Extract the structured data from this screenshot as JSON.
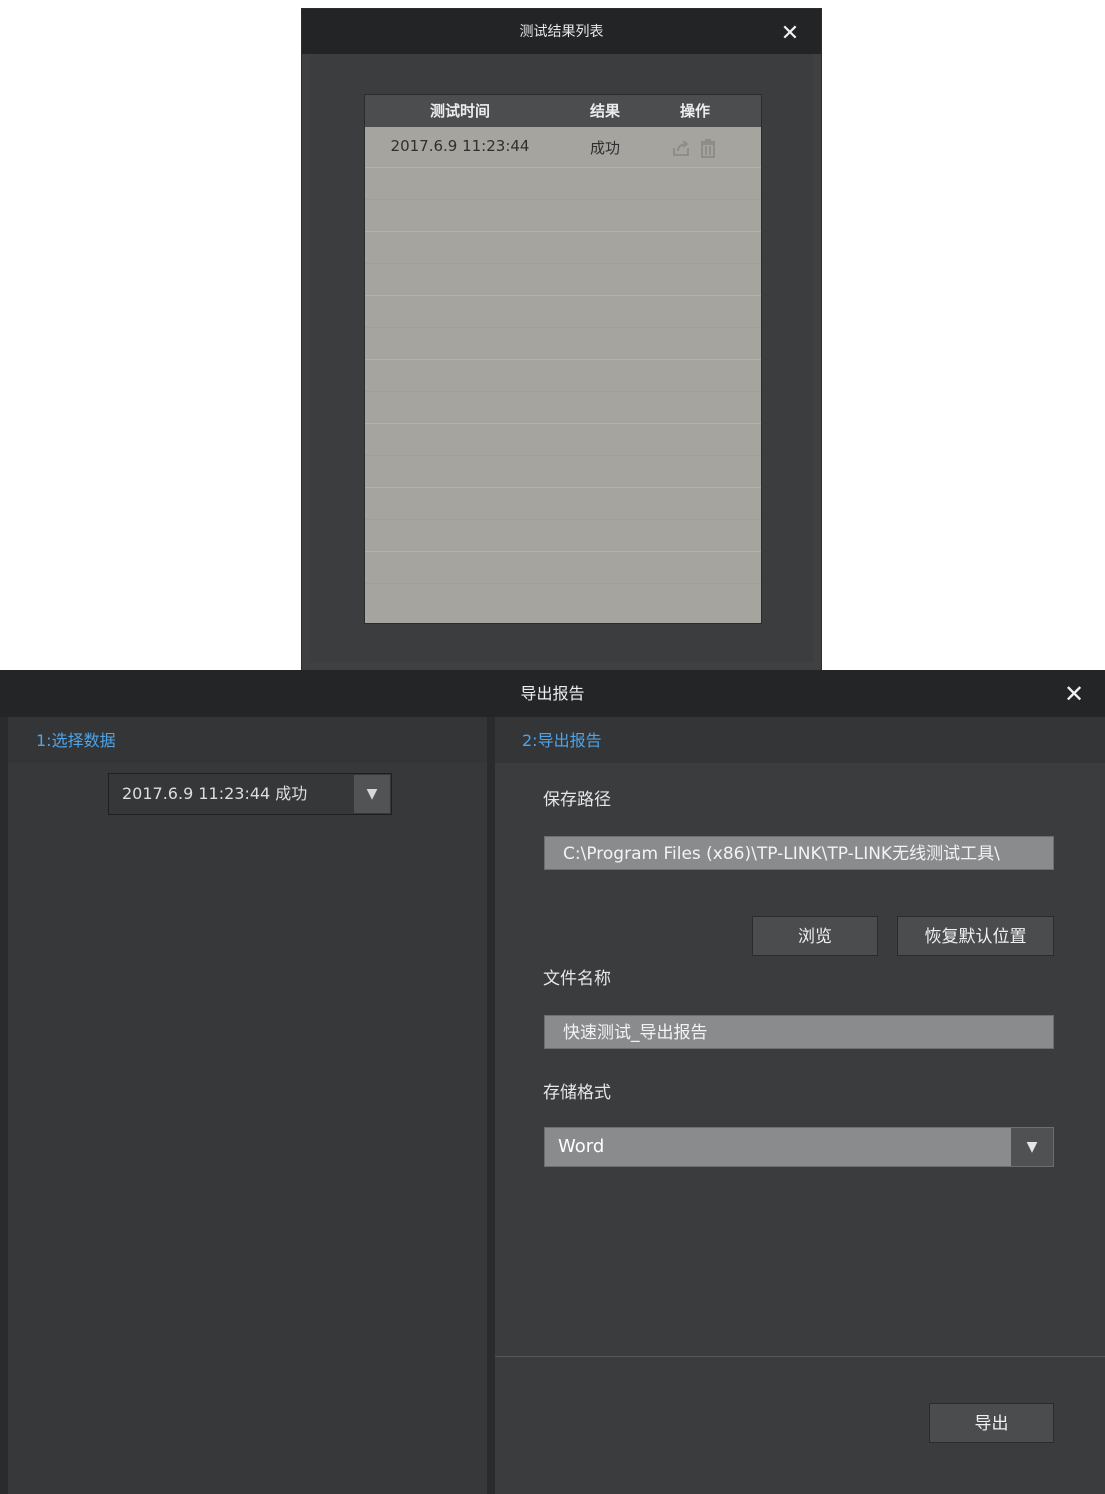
{
  "results_dialog": {
    "title": "测试结果列表",
    "close_glyph": "✕",
    "table": {
      "columns": [
        "测试时间",
        "结果",
        "操作"
      ],
      "rows": [
        {
          "time": "2017.6.9 11:23:44",
          "result": "成功",
          "actions": [
            "export-icon",
            "trash-icon"
          ]
        }
      ]
    }
  },
  "export_dialog": {
    "title": "导出报告",
    "close_glyph": "✕",
    "left": {
      "step_label": "1:选择数据",
      "data_select": {
        "value": "2017.6.9 11:23:44 成功",
        "arrow": "▼"
      }
    },
    "right": {
      "step_label": "2:导出报告",
      "save_path_label": "保存路径",
      "save_path_value": "C:\\Program Files (x86)\\TP-LINK\\TP-LINK无线测试工具\\",
      "browse_label": "浏览",
      "restore_default_label": "恢复默认位置",
      "filename_label": "文件名称",
      "filename_value": "快速测试_导出报告",
      "format_label": "存储格式",
      "format_select": {
        "value": "Word",
        "arrow": "▼"
      },
      "export_label": "导出"
    }
  },
  "colors": {
    "titlebar": "#232527",
    "accent_blue": "#4fa3e6",
    "table_bg": "#a5a49e",
    "field_bg": "#8a8b8c"
  }
}
